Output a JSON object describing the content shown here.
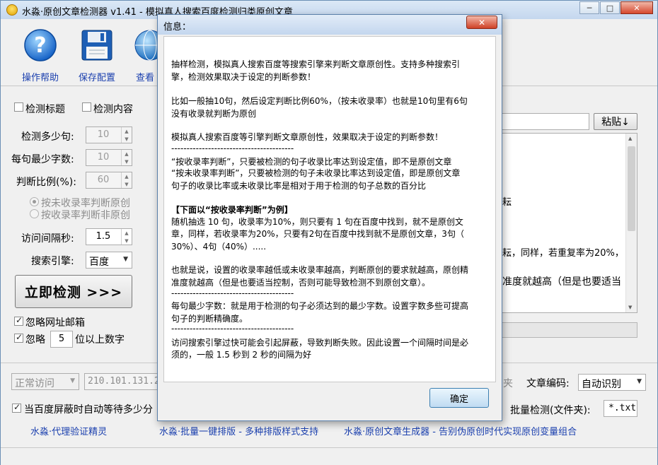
{
  "window": {
    "title": "水淼·原创文章检测器 v1.41 - 模拟真人搜索百度检测归类原创文章",
    "minimize": "─",
    "maximize": "□",
    "close": "✕"
  },
  "toolbar": {
    "help": {
      "label": "操作帮助",
      "icon": "help-icon"
    },
    "save": {
      "label": "保存配置",
      "icon": "save-icon"
    },
    "view": {
      "label": "查看",
      "icon": "globe-icon"
    }
  },
  "options": {
    "check_title": "检测标题",
    "check_content": "检测内容",
    "sentences_label": "检测多少句:",
    "sentences_value": "10",
    "min_chars_label": "每句最少字数:",
    "min_chars_value": "10",
    "ratio_label": "判断比例(%):",
    "ratio_value": "60",
    "radio_unindexed": "按未收录率判断原创",
    "radio_indexed": "按收录率判断非原创",
    "interval_label": "访问间隔秒:",
    "interval_value": "1.5",
    "engine_label": "搜索引擎:",
    "engine_value": "百度",
    "start_button": "立即检测 >>>",
    "ignore_url": "忽略网址邮箱",
    "ignore_digits_prefix": "忽略",
    "ignore_digits_value": "5",
    "ignore_digits_suffix": "位以上数字"
  },
  "right_panel": {
    "paste_button": "粘贴↓",
    "textarea_line1": "耘",
    "textarea_line2": "耘，同样，若重复率为20%，",
    "textarea_line3": "准度就越高（但是也要适当"
  },
  "bottom": {
    "access_mode": "正常访问",
    "ip_value": "210.101.131.2",
    "folder_fragment": "夹",
    "encoding_label": "文章编码:",
    "encoding_value": "自动识别",
    "auto_wait": "当百度屏蔽时自动等待多少分",
    "batch_label": "批量检测(文件夹):",
    "ext_value": "*.txt"
  },
  "links": {
    "link1": "水淼·代理验证精灵",
    "link2": "水淼·批量一键排版 - 多种排版样式支持",
    "link3": "水淼·原创文章生成器 - 告别伪原创时代实现原创变量组合"
  },
  "dialog": {
    "title": "信息：",
    "close": "✕",
    "ok_button": "确定",
    "lines": [
      "抽样检测，模拟真人搜索百度等搜索引擎来判断文章原创性。支持多种搜索引",
      "擎，检测效果取决于设定的判断参数！",
      "比如一般抽10句，然后设定判断比例60%，（按未收录率）也就是10句里有6句",
      "没有收录就判断为原创",
      "模拟真人搜索百度等引擎判断文章原创性，效果取决于设定的判断参数！",
      "----------------------------------------",
      "“按收录率判断”，只要被检测的句子收录比率达到设定值，即不是原创文章",
      "“按未收录率判断”，只要被检测的句子未收录比率达到设定值，即是原创文章",
      "句子的收录比率或未收录比率是相对于用于检测的句子总数的百分比",
      "【下面以“按收录率判断”为例】",
      "随机抽选 10 句，收录率为10%，则只要有 1 句在百度中找到，就不是原创文",
      "章，同样，若收录率为20%，只要有2句在百度中找到就不是原创文章，3句（",
      "30%）、4句（40%）.....",
      "也就是说，设置的收录率越低或未收录率越高，判断原创的要求就越高，原创精",
      "准度就越高（但是也要适当控制，否则可能导致检测不到原创文章）。",
      "----------------------------------------",
      "每句最少字数：就是用于检测的句子必须达到的最少字数。设置字数多些可提高",
      "句子的判断精确度。",
      "----------------------------------------",
      "访问搜索引擎过快可能会引起屏蔽，导致判断失败。因此设置一个间隔时间是必",
      "须的，一般 1.5 秒到 2 秒的间隔为好"
    ]
  }
}
